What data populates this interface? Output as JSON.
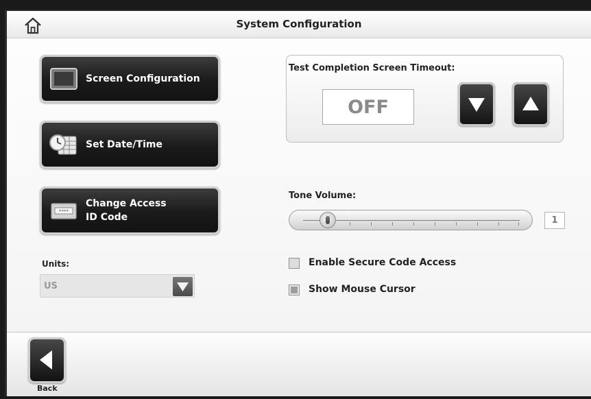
{
  "header": {
    "title": "System Configuration",
    "home_icon": "home-icon"
  },
  "buttons": {
    "screen_config": {
      "label": "Screen Configuration",
      "icon": "monitor-icon"
    },
    "date_time": {
      "label": "Set Date/Time",
      "icon": "clock-calendar-icon"
    },
    "access_code": {
      "line1": "Change Access",
      "line2": "ID Code",
      "icon": "keypad-icon"
    }
  },
  "units": {
    "label": "Units:",
    "value": "US"
  },
  "timeout": {
    "label": "Test Completion Screen Timeout:",
    "value": "OFF"
  },
  "tone": {
    "label": "Tone Volume:",
    "value": "1",
    "level": 1,
    "min": 0,
    "max": 10
  },
  "options": {
    "secure_code": {
      "label": "Enable Secure Code Access",
      "checked": false
    },
    "mouse_cursor": {
      "label": "Show Mouse Cursor",
      "checked": true
    }
  },
  "footer": {
    "back_label": "Back"
  }
}
